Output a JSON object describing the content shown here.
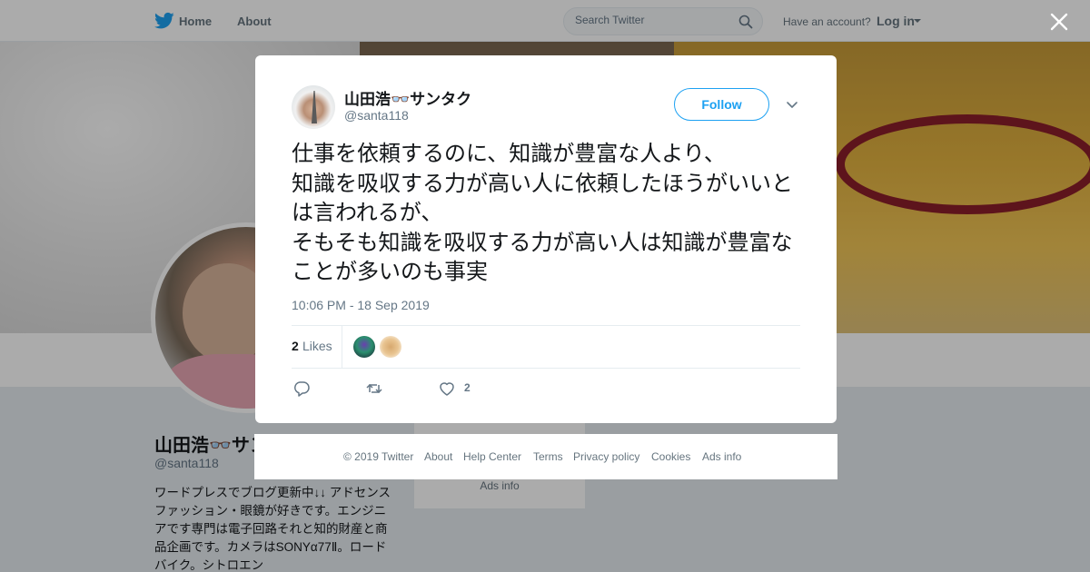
{
  "nav": {
    "home": "Home",
    "about": "About",
    "search_placeholder": "Search Twitter",
    "have_account": "Have an account?",
    "login": "Log in"
  },
  "profile": {
    "name": "山田浩👓サンタク",
    "handle": "@santa118",
    "bio": "ワードプレスでブログ更新中↓↓ アドセンス　ファッション・眼鏡が好きです。エンジニアです専門は電子回路それと知的財産と商品企画です。カメラはSONYα77Ⅱ。ロードバイク。シトロエン"
  },
  "side_card": {
    "ads_info": "Ads info"
  },
  "tweet": {
    "author_name": "山田浩👓サンタク",
    "author_handle": "@santa118",
    "follow_label": "Follow",
    "text": "仕事を依頼するのに、知識が豊富な人より、\n知識を吸収する力が高い人に依頼したほうがいいとは言われるが、\nそもそも知識を吸収する力が高い人は知識が豊富なことが多いのも事実",
    "timestamp": "10:06 PM - 18 Sep 2019",
    "likes_count": "2",
    "likes_label": "Likes",
    "like_action_count": "2"
  },
  "footer": {
    "copyright": "© 2019 Twitter",
    "about": "About",
    "help": "Help Center",
    "terms": "Terms",
    "privacy": "Privacy policy",
    "cookies": "Cookies",
    "ads": "Ads info"
  },
  "colors": {
    "accent": "#1da1f2",
    "muted": "#657786"
  }
}
